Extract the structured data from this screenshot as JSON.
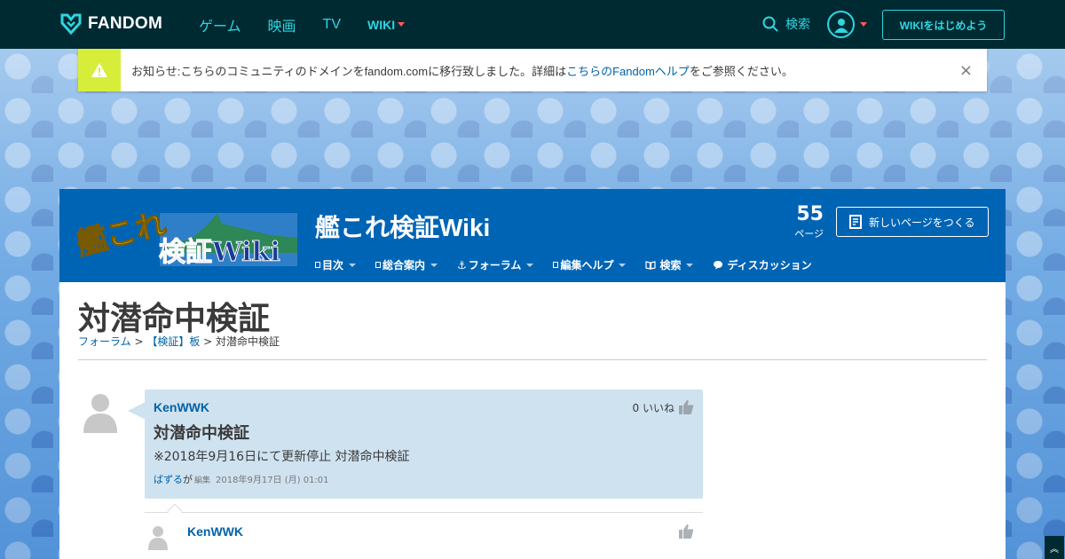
{
  "topnav": {
    "brand": "FANDOM",
    "links": [
      "ゲーム",
      "映画",
      "TV"
    ],
    "wiki_label": "WIKI",
    "search_label": "検索",
    "start_wiki_label": "WIKIをはじめよう",
    "colors": {
      "bg": "#002a32",
      "accent": "#2fd6e0",
      "caret": "#ff5a5a"
    }
  },
  "notice": {
    "prefix": "お知らせ:こちらのコミュニティのドメインをfandom.comに移行致しました。詳細は",
    "link": "こちらのFandomヘルプ",
    "suffix": "をご参照ください。",
    "close": "×",
    "icon": "warning-icon",
    "icon_bg": "#d6ee3a"
  },
  "wiki": {
    "logo_top": "艦これ",
    "logo_bottom": "検証Wiki",
    "title": "艦これ検証Wiki",
    "page_count": "55",
    "page_count_label": "ページ",
    "new_page_label": "新しいページをつくる",
    "nav": [
      {
        "label": "目次"
      },
      {
        "label": "総合案内"
      },
      {
        "label": "フォーラム"
      },
      {
        "label": "編集ヘルプ"
      },
      {
        "label": "検索"
      },
      {
        "label": "ディスカッション"
      }
    ],
    "header_color": "#0064b5"
  },
  "page": {
    "title": "対潜命中検証",
    "breadcrumb": {
      "forum": "フォーラム",
      "sep1": " > ",
      "board": "【検証】板",
      "sep2": " > ",
      "current": "対潜命中検証"
    }
  },
  "post": {
    "author": "KenWWK",
    "likes_text": "0 いいね",
    "title": "対潜命中検証",
    "body": "※2018年9月16日にて更新停止 対潜命中検証",
    "editor": "ばずる",
    "edited_particle": " が",
    "edited_label": "編集",
    "timestamp": "2018年9月17日 (月) 01:01"
  },
  "reply": {
    "author": "KenWWK"
  },
  "scroll_top": "︽"
}
